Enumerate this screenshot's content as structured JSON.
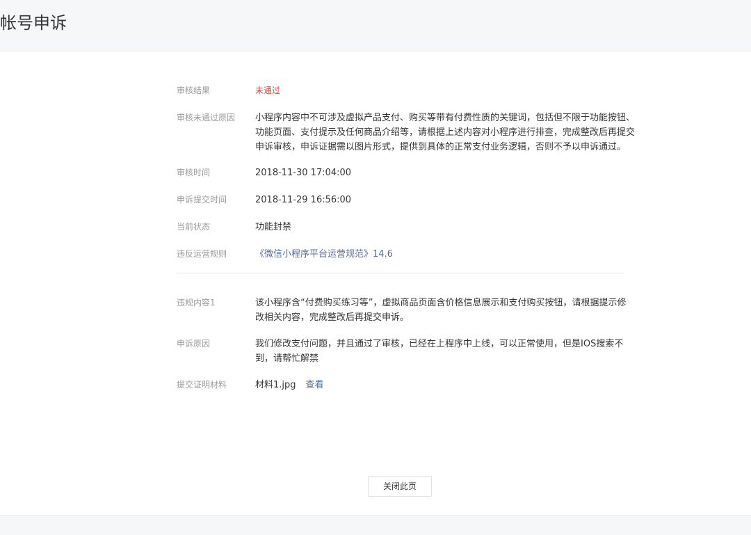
{
  "header": {
    "title": "帐号申诉"
  },
  "audit": {
    "result_label": "审核结果",
    "result_value": "未通过",
    "reason_label": "审核未通过原因",
    "reason_lines": [
      "小程序内容中不可涉及虚拟产品支付、购买等带有付费性质的关键词，包括但不限于功能按钮、",
      "功能页面、支付提示及任何商品介绍等，请根据上述内容对小程序进行排查，完成整改后再提交",
      "申诉审核，申诉证据需以图片形式，提供到具体的正常支付业务逻辑，否则不予以申诉通过。"
    ],
    "time_label": "审核时间",
    "time_value": "2018-11-30 17:04:00",
    "submit_time_label": "申诉提交时间",
    "submit_time_value": "2018-11-29 16:56:00",
    "status_label": "当前状态",
    "status_value": "功能封禁",
    "rule_label": "违反运营规则",
    "rule_value": "《微信小程序平台运营规范》14.6"
  },
  "violation": {
    "content_label": "违规内容1",
    "content_lines": [
      "该小程序含“付费购买练习等”，虚拟商品页面含价格信息展示和支付购买按钮，请根据提示修",
      "改相关内容，完成整改后再提交申诉。"
    ],
    "appeal_reason_label": "申诉原因",
    "appeal_reason_lines": [
      "我们修改支付问题，并且通过了审核，已经在上程序中上线，可以正常使用，但是IOS搜索不",
      "到，请帮忙解禁"
    ],
    "evidence_label": "提交证明材料",
    "evidence_file": "材料1.jpg",
    "view_label": "查看"
  },
  "actions": {
    "close_label": "关闭此页"
  }
}
